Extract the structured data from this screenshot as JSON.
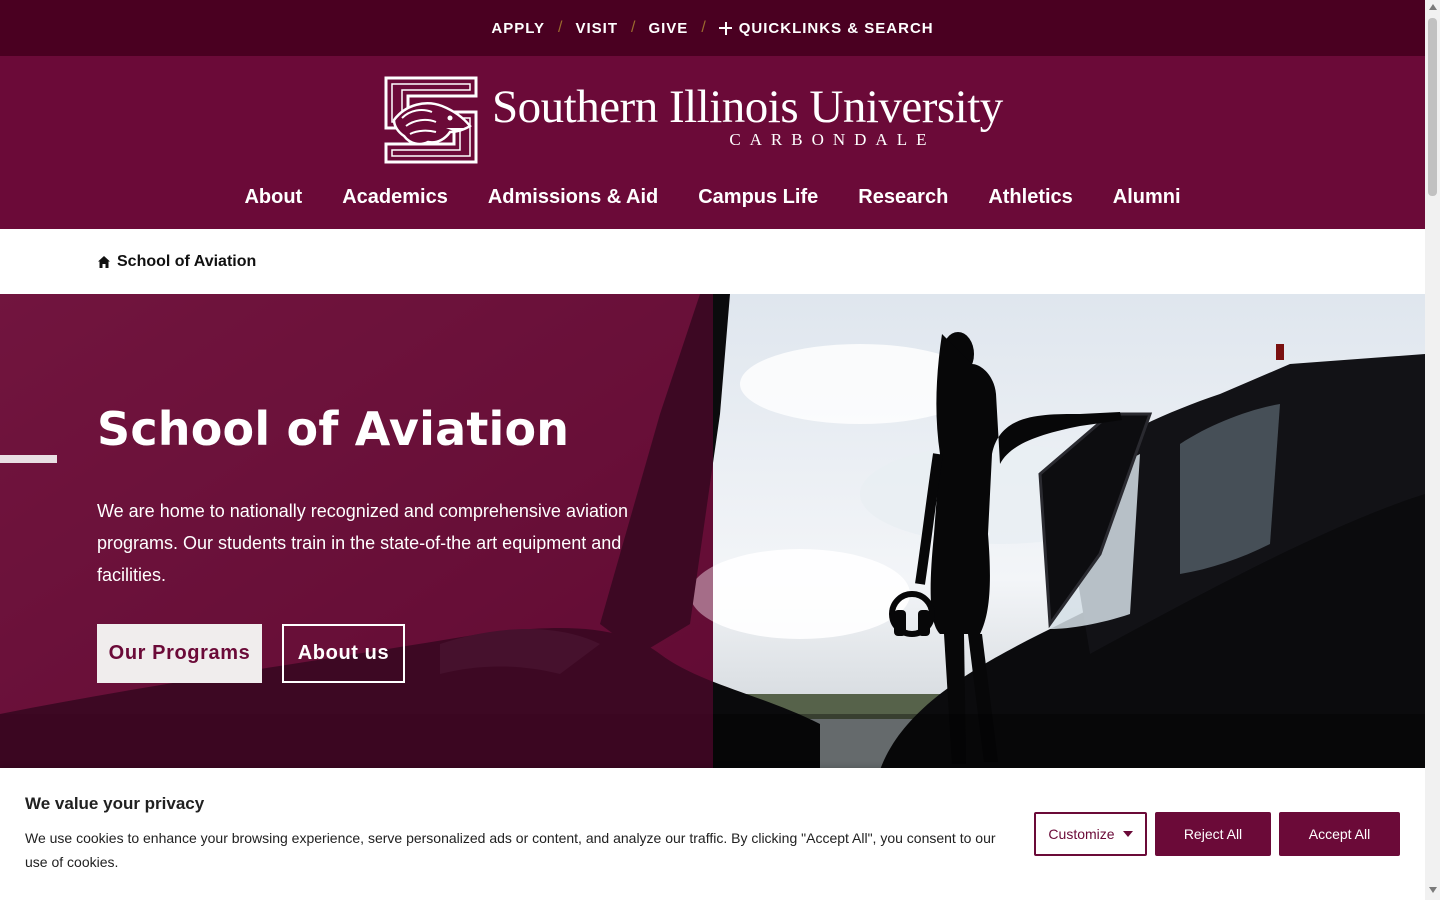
{
  "utility_nav": {
    "apply": "APPLY",
    "visit": "VISIT",
    "give": "GIVE",
    "separator": "/",
    "quicklinks": "QUICKLINKS & SEARCH"
  },
  "logo": {
    "name": "Southern Illinois University",
    "subtitle": "CARBONDALE"
  },
  "main_nav": {
    "items": [
      {
        "label": "About"
      },
      {
        "label": "Academics"
      },
      {
        "label": "Admissions & Aid"
      },
      {
        "label": "Campus Life"
      },
      {
        "label": "Research"
      },
      {
        "label": "Athletics"
      },
      {
        "label": "Alumni"
      }
    ]
  },
  "breadcrumb": {
    "label": "School of Aviation"
  },
  "hero": {
    "title": "School of Aviation",
    "text": "We are home to nationally recognized and comprehensive aviation programs. Our students train in the state-of-the art equipment and facilities.",
    "primary_button": "Our Programs",
    "secondary_button": "About us"
  },
  "cookie": {
    "title": "We value your privacy",
    "text": "We use cookies to enhance your browsing experience, serve personalized ads or content, and analyze our traffic. By clicking \"Accept All\", you consent to our use of cookies.",
    "customize": "Customize",
    "reject": "Reject All",
    "accept": "Accept All"
  },
  "colors": {
    "maroon": "#6b0a38",
    "dark_maroon": "#4a0021",
    "separator_gold": "#9b6a2e"
  }
}
